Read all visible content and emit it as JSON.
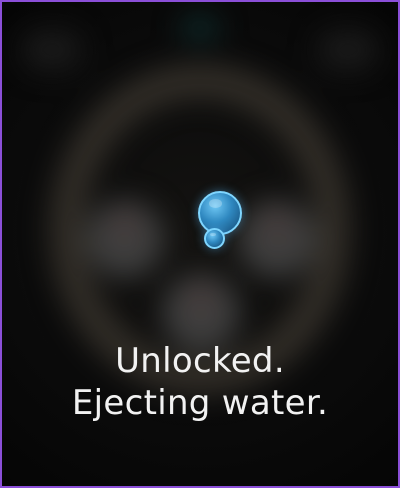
{
  "status": {
    "line1": "Unlocked.",
    "line2": "Ejecting water."
  },
  "colors": {
    "border": "#8b4fd8",
    "background": "#050505",
    "bubble": "#2f88c0",
    "bubble_outline": "#7fd6ff",
    "text": "#f2f2f2"
  },
  "icons": {
    "status_animation": "water-bubbles-icon"
  }
}
